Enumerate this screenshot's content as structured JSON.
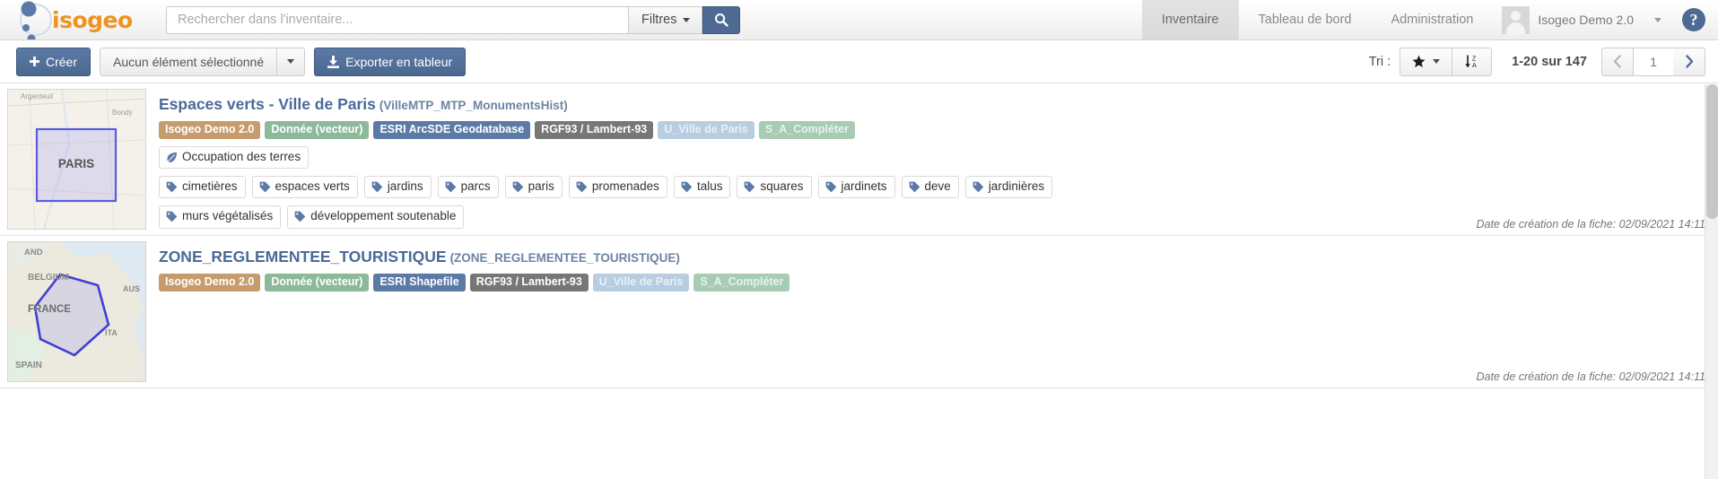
{
  "header": {
    "logo_text": "isogeo",
    "search": {
      "placeholder": "Rechercher dans l'inventaire...",
      "value": "",
      "filters_label": "Filtres",
      "search_icon": "search-icon"
    },
    "nav": [
      {
        "label": "Inventaire",
        "active": true
      },
      {
        "label": "Tableau de bord",
        "active": false
      },
      {
        "label": "Administration",
        "active": false
      }
    ],
    "user": {
      "name": "Isogeo Demo 2.0",
      "avatar_icon": "user-avatar-icon",
      "caret_icon": "chevron-down-icon"
    },
    "help_label": "?",
    "accent_color": "#4d6a94",
    "logo_color": "#f0921f"
  },
  "toolbar": {
    "create_label": "Créer",
    "create_icon": "plus-icon",
    "selection_label": "Aucun élément sélectionné",
    "selection_caret_icon": "chevron-down-icon",
    "export_label": "Exporter en tableur",
    "export_icon": "download-icon",
    "sort_label": "Tri :",
    "sort_star_icon": "star-icon",
    "sort_caret_icon": "chevron-down-icon",
    "sort_order_icon": "sort-za-icon",
    "count_label": "1-20 sur 147",
    "pager": {
      "prev_icon": "chevron-left-icon",
      "next_icon": "chevron-right-icon",
      "current_page": "1"
    }
  },
  "results": [
    {
      "title": "Espaces verts - Ville de Paris",
      "subtitle": "(VilleMTP_MTP_MonumentsHist)",
      "thumbnail": "map-thumbnail-paris",
      "thumbnail_label": "PARIS",
      "badges": [
        {
          "text": "Isogeo Demo 2.0",
          "color": "#c69c6d"
        },
        {
          "text": "Donnée (vecteur)",
          "color": "#8cb99a"
        },
        {
          "text": "ESRI ArcSDE Geodatabase",
          "color": "#5b7aa6"
        },
        {
          "text": "RGF93 / Lambert-93",
          "color": "#777777"
        },
        {
          "text": "U_Ville de Paris",
          "color": "#b8cde0"
        },
        {
          "text": "S_A_Compléter",
          "color": "#a8cbb4"
        }
      ],
      "themes": [
        {
          "label": "Occupation des terres",
          "icon": "leaf-icon"
        }
      ],
      "keywords": [
        "cimetières",
        "espaces verts",
        "jardins",
        "parcs",
        "paris",
        "promenades",
        "talus",
        "squares",
        "jardinets",
        "deve",
        "jardinières",
        "murs végétalisés",
        "développement soutenable"
      ],
      "date": "Date de création de la fiche: 02/09/2021 14:11"
    },
    {
      "title": "ZONE_REGLEMENTEE_TOURISTIQUE",
      "subtitle": "(ZONE_REGLEMENTEE_TOURISTIQUE)",
      "thumbnail": "map-thumbnail-france",
      "thumbnail_label": "FRANCE",
      "badges": [
        {
          "text": "Isogeo Demo 2.0",
          "color": "#c69c6d"
        },
        {
          "text": "Donnée (vecteur)",
          "color": "#8cb99a"
        },
        {
          "text": "ESRI Shapefile",
          "color": "#5b7aa6"
        },
        {
          "text": "RGF93 / Lambert-93",
          "color": "#777777"
        },
        {
          "text": "U_Ville de Paris",
          "color": "#b8cde0"
        },
        {
          "text": "S_A_Compléter",
          "color": "#a8cbb4"
        }
      ],
      "themes": [],
      "keywords": [],
      "date": "Date de création de la fiche: 02/09/2021 14:11"
    }
  ]
}
